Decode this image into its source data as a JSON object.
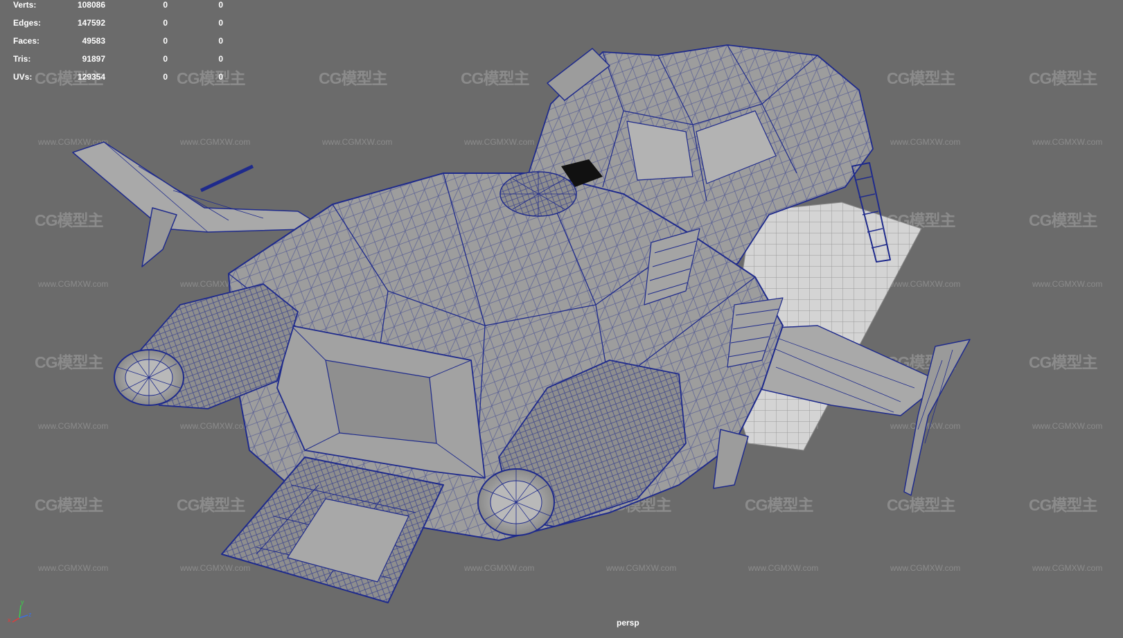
{
  "stats": [
    {
      "label": "Verts:",
      "v1": "108086",
      "v2": "0",
      "v3": "0"
    },
    {
      "label": "Edges:",
      "v1": "147592",
      "v2": "0",
      "v3": "0"
    },
    {
      "label": "Faces:",
      "v1": "49583",
      "v2": "0",
      "v3": "0"
    },
    {
      "label": "Tris:",
      "v1": "91897",
      "v2": "0",
      "v3": "0"
    },
    {
      "label": "UVs:",
      "v1": "129354",
      "v2": "0",
      "v3": "0"
    }
  ],
  "camera": "persp",
  "axes": {
    "x": "x",
    "y": "y",
    "z": "z"
  },
  "watermark": {
    "logo": "CG模型主",
    "url": "www.CGMXW.com"
  },
  "colors": {
    "viewport_bg": "#6b6b6b",
    "wireframe": "#1e2a8c",
    "mesh_fill": "#9b9b9b"
  }
}
